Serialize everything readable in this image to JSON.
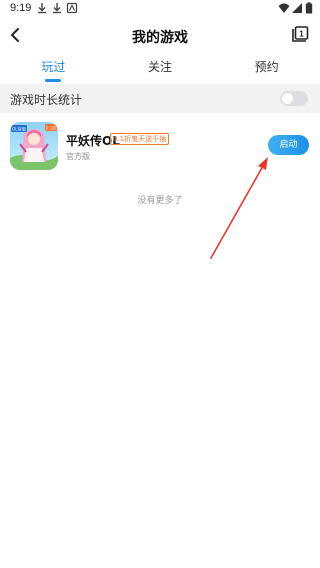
{
  "status_bar": {
    "time": "9:19",
    "icons": [
      "download-icon",
      "download-icon",
      "notification-icon",
      "wifi-icon",
      "signal-icon",
      "battery-icon"
    ]
  },
  "header": {
    "title": "我的游戏",
    "back_icon": "back-arrow-icon",
    "right_icon": "book-icon",
    "right_icon_text": "1"
  },
  "tabs": [
    {
      "label": "玩过",
      "active": true
    },
    {
      "label": "关注",
      "active": false
    },
    {
      "label": "预约",
      "active": false
    }
  ],
  "playtime_stats": {
    "label": "游戏时长统计",
    "enabled": false
  },
  "games": [
    {
      "name": "平妖传OL",
      "tag": "0.1折鬼天送千抽",
      "subtitle": "官方版",
      "action_label": "启动",
      "icon": "game-cover-icon",
      "icon_badge": "0.1折",
      "icon_corner_label": "OL官版"
    }
  ],
  "footer_text": "没有更多了",
  "annotation": {
    "arrow_color": "#e03a2f"
  },
  "colors": {
    "accent": "#1a8fe3",
    "tag": "#f07a30",
    "stats_background": "#f1f2f4"
  }
}
